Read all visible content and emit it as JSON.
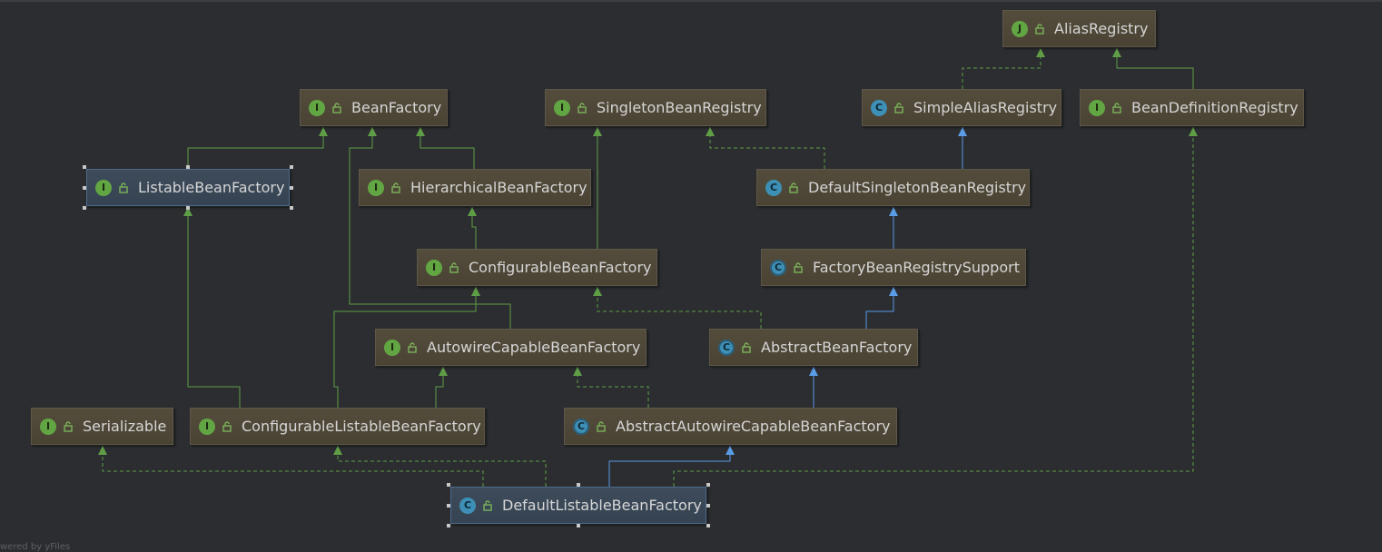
{
  "diagram": {
    "nodes": [
      {
        "id": "aliasregistry",
        "label": "AliasRegistry",
        "kind": "j",
        "kind_letter": "J"
      },
      {
        "id": "beanfactory",
        "label": "BeanFactory",
        "kind": "i",
        "kind_letter": "I"
      },
      {
        "id": "singletonbeanregistry",
        "label": "SingletonBeanRegistry",
        "kind": "i",
        "kind_letter": "I"
      },
      {
        "id": "simplealiasregistry",
        "label": "SimpleAliasRegistry",
        "kind": "c",
        "kind_letter": "C"
      },
      {
        "id": "beandefinitionregistry",
        "label": "BeanDefinitionRegistry",
        "kind": "i",
        "kind_letter": "I"
      },
      {
        "id": "listablebeanfactory",
        "label": "ListableBeanFactory",
        "kind": "i",
        "kind_letter": "I",
        "selected": true
      },
      {
        "id": "hierarchicalbeanfactory",
        "label": "HierarchicalBeanFactory",
        "kind": "i",
        "kind_letter": "I"
      },
      {
        "id": "defaultsingletonbeanregistry",
        "label": "DefaultSingletonBeanRegistry",
        "kind": "c",
        "kind_letter": "C"
      },
      {
        "id": "configurablebeanfactory",
        "label": "ConfigurableBeanFactory",
        "kind": "i",
        "kind_letter": "I"
      },
      {
        "id": "factorybeanregistrysupport",
        "label": "FactoryBeanRegistrySupport",
        "kind": "ac",
        "kind_letter": "C"
      },
      {
        "id": "autowirecapablebeanfactory",
        "label": "AutowireCapableBeanFactory",
        "kind": "i",
        "kind_letter": "I"
      },
      {
        "id": "abstractbeanfactory",
        "label": "AbstractBeanFactory",
        "kind": "ac",
        "kind_letter": "C"
      },
      {
        "id": "serializable",
        "label": "Serializable",
        "kind": "i",
        "kind_letter": "I"
      },
      {
        "id": "configurablelistablebeanfactory",
        "label": "ConfigurableListableBeanFactory",
        "kind": "i",
        "kind_letter": "I"
      },
      {
        "id": "abstractautowirecapablebeanfactory",
        "label": "AbstractAutowireCapableBeanFactory",
        "kind": "ac",
        "kind_letter": "C"
      },
      {
        "id": "defaultlistablebeanfactory",
        "label": "DefaultListableBeanFactory",
        "kind": "c",
        "kind_letter": "C",
        "selected": true
      }
    ],
    "footer_text": "wered by yFiles",
    "colors": {
      "interface_extends": "#5f9e46",
      "class_extends": "#5a9ce6",
      "implements": "#5f9e46"
    }
  }
}
